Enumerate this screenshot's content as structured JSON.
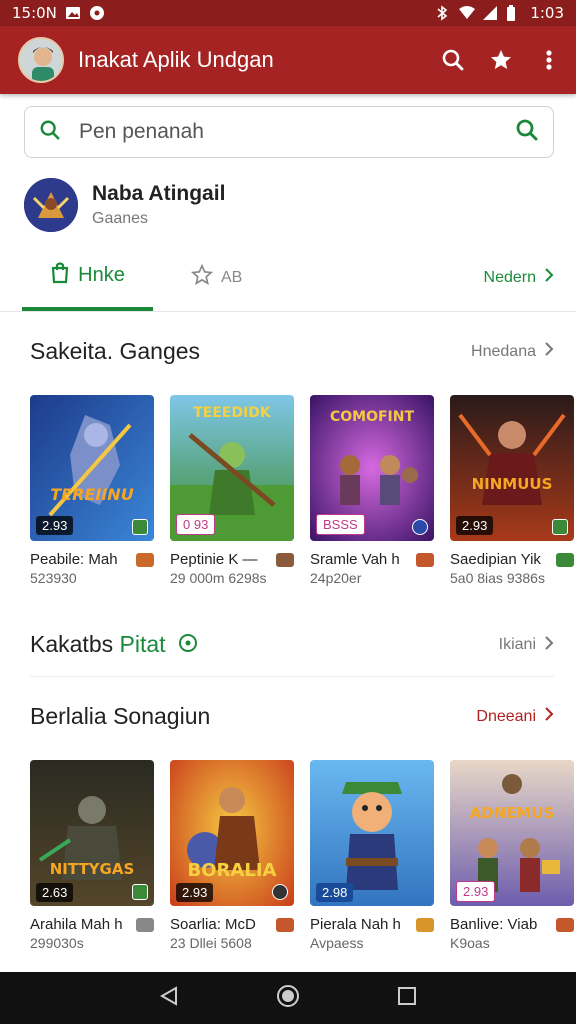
{
  "status_bar": {
    "time": "15:0N",
    "battery_text": "1:03"
  },
  "app_bar": {
    "title": "Inakat Aplik Undgan",
    "icons": [
      "search-icon",
      "star-icon",
      "more-vert-icon"
    ]
  },
  "search": {
    "value": "Pen penanah"
  },
  "profile": {
    "name": "Naba Atingail",
    "subtitle": "Gaanes"
  },
  "tabs": {
    "items": [
      {
        "label": "Hnke",
        "icon": "store-icon"
      },
      {
        "label": "AB",
        "icon": "star-outline-icon"
      }
    ],
    "more_label": "Nedern"
  },
  "section1": {
    "title": "Sakeita. Ganges",
    "link": "Hnedana",
    "games": [
      {
        "name": "Peabile: Mah",
        "meta": "523930",
        "badge": "2.93",
        "art": "TEREIINU"
      },
      {
        "name": "Peptinie K —",
        "meta": "29 000m 6298s",
        "badge": "0 93",
        "art": "TEEEDIDK"
      },
      {
        "name": "Sramle Vah h",
        "meta": "24p20er",
        "badge": "BSSS",
        "art": "COMOFINT"
      },
      {
        "name": "Saedipian Yik",
        "meta": "5a0 8ias 9386s",
        "badge": "2.93",
        "art": "NINMUUS"
      }
    ]
  },
  "promo": {
    "title_a": "Kakatbs",
    "title_b": "Pitat",
    "link": "Ikiani"
  },
  "section2": {
    "title": "Berlalia Sonagiun",
    "link": "Dneeani",
    "games": [
      {
        "name": "Arahila Mah h",
        "meta": "299030s",
        "badge": "2.63",
        "art": "NITTYGAS"
      },
      {
        "name": "Soarlia: McD",
        "meta": "23 Dllei 5608",
        "badge": "2.93",
        "art": "BORALIA"
      },
      {
        "name": "Pierala Nah h",
        "meta": "Avpaess",
        "badge": "2.98",
        "art": ""
      },
      {
        "name": "Banlive: Viab",
        "meta": "K9oas",
        "badge": "2.93",
        "art": "ADNEMUS"
      }
    ]
  },
  "colors": {
    "primary": "#a52423",
    "status": "#8c1d1d",
    "accent": "#1a8a3a"
  }
}
